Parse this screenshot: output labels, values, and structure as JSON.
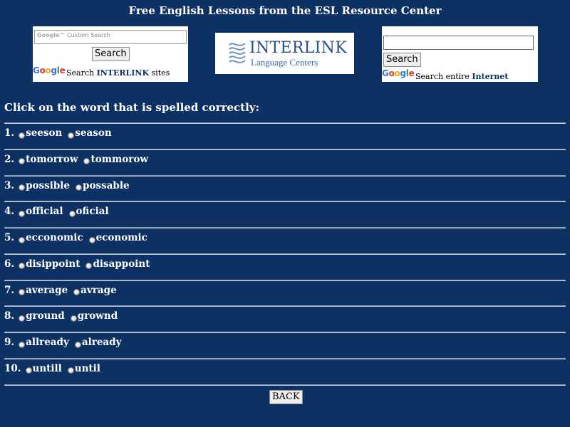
{
  "header": {
    "title": "Free English Lessons from the ESL Resource Center"
  },
  "search_left": {
    "input_placeholder": "Custom Search",
    "placeholder_brand": "Google™",
    "button_label": "Search",
    "caption_prefix": "Search ",
    "caption_strong": "INTERLINK",
    "caption_suffix": " sites",
    "google_icon": "google-logo"
  },
  "search_right": {
    "input_value": "",
    "button_label": "Search",
    "caption_prefix": "Search entire ",
    "caption_strong": "Internet",
    "google_icon": "google-logo"
  },
  "logo": {
    "title": "INTERLINK",
    "subtitle": "Language Centers",
    "icon": "interlink-wave-icon"
  },
  "instruction": "Click on the word that is spelled correctly:",
  "questions": [
    {
      "number": "1.",
      "options": [
        "seeson",
        "season"
      ]
    },
    {
      "number": "2.",
      "options": [
        "tomorrow",
        "tommorow"
      ]
    },
    {
      "number": "3.",
      "options": [
        "possible",
        "possable"
      ]
    },
    {
      "number": "4.",
      "options": [
        "official",
        "oficial"
      ]
    },
    {
      "number": "5.",
      "options": [
        "ecconomic",
        "economic"
      ]
    },
    {
      "number": "6.",
      "options": [
        "disippoint",
        "disappoint"
      ]
    },
    {
      "number": "7.",
      "options": [
        "average",
        "avrage"
      ]
    },
    {
      "number": "8.",
      "options": [
        "ground",
        "grownd"
      ]
    },
    {
      "number": "9.",
      "options": [
        "allready",
        "already"
      ]
    },
    {
      "number": "10.",
      "options": [
        "untill",
        "until"
      ]
    }
  ],
  "back_button": "BACK",
  "colors": {
    "background": "#0d3163",
    "text": "#ffffff",
    "rule": "#c7d0dc"
  }
}
